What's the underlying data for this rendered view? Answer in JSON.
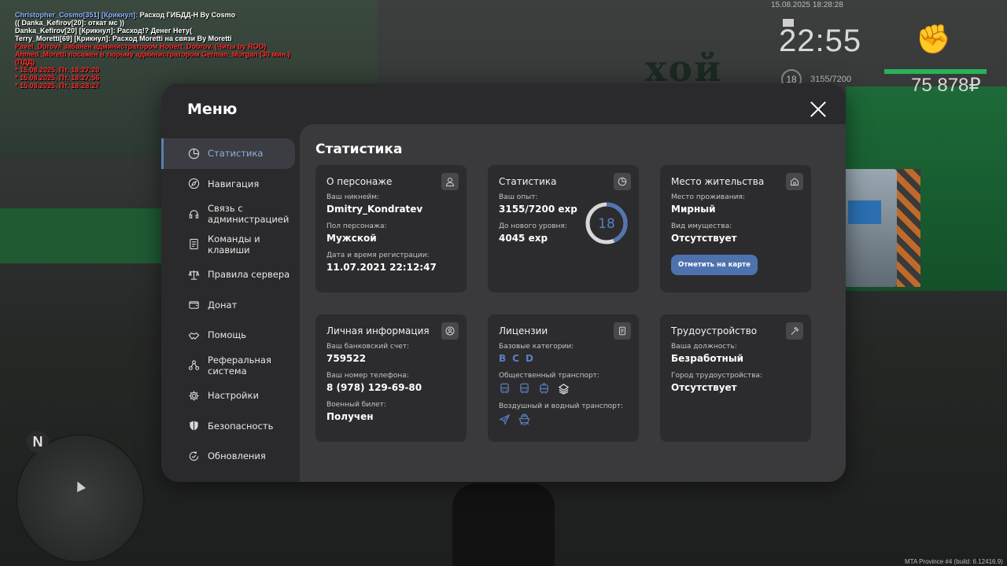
{
  "chat": [
    {
      "color": "blue",
      "prefix": "Christopher_Cosmo[351] [Крикнул]:",
      "text": " Расход ГИБДД-Н By Cosmo"
    },
    {
      "color": "white",
      "prefix": "",
      "text": "(( Danka_Kefirov[20]: откат мс ))"
    },
    {
      "color": "white",
      "prefix": "",
      "text": "Danka_Kefirov[20] [Крикнул]: Расход!? Денег Нету("
    },
    {
      "color": "white",
      "prefix": "",
      "text": "Terry_Moretti[69] [Крикнул]: Расход Moretti на связи By Moretti"
    },
    {
      "color": "red",
      "prefix": "",
      "text": "Pavel_Durov# забанен администратором Hobert_Dobrov. (Читы by ROD)"
    },
    {
      "color": "red",
      "prefix": "",
      "text": "Ahmed_Moretti посажен в тюрьму администратором German_Morgan (30 мин.)"
    },
    {
      "color": "red",
      "prefix": "",
      "text": "(ПДД)"
    },
    {
      "color": "red",
      "prefix": "",
      "text": "* 15.08.2025, Пт, 18:27:20"
    },
    {
      "color": "red",
      "prefix": "",
      "text": "* 15.08.2025, Пт, 18:27:56"
    },
    {
      "color": "red",
      "prefix": "",
      "text": "* 15.08.2025, Пт, 18:28:27"
    }
  ],
  "hud": {
    "date": "15.08.2025 18:28:28",
    "time": "22:55",
    "level": "18",
    "exp": "3155/7200",
    "health_fraction": 1.0,
    "money": "75 878₽"
  },
  "background": {
    "store_sign": "хой"
  },
  "minimap": {
    "north": "N"
  },
  "build": "MTA Province #4 (build: 6.12416.9)",
  "menu": {
    "title": "Меню",
    "sidebar": [
      {
        "label": "Статистика",
        "icon": "pie-chart-icon",
        "active": true
      },
      {
        "label": "Навигация",
        "icon": "compass-icon",
        "active": false
      },
      {
        "label": "Связь с администрацией",
        "icon": "headset-icon",
        "active": false
      },
      {
        "label": "Команды и клавиши",
        "icon": "document-icon",
        "active": false
      },
      {
        "label": "Правила сервера",
        "icon": "scales-icon",
        "active": false
      },
      {
        "label": "Донат",
        "icon": "wallet-icon",
        "active": false
      },
      {
        "label": "Помощь",
        "icon": "handshake-icon",
        "active": false
      },
      {
        "label": "Реферальная система",
        "icon": "network-icon",
        "active": false
      },
      {
        "label": "Настройки",
        "icon": "gear-icon",
        "active": false
      },
      {
        "label": "Безопасность",
        "icon": "shield-icon",
        "active": false
      },
      {
        "label": "Обновления",
        "icon": "refresh-check-icon",
        "active": false
      }
    ],
    "content_title": "Статистика",
    "cards": {
      "character": {
        "title": "О персонаже",
        "nick_label": "Ваш никнейм:",
        "nick": "Dmitry_Kondratev",
        "gender_label": "Пол персонажа:",
        "gender": "Мужской",
        "reg_label": "Дата и время регистрации:",
        "reg": "11.07.2021 22:12:47"
      },
      "stats": {
        "title": "Статистика",
        "exp_label": "Ваш опыт:",
        "exp": "3155/7200 exp",
        "next_label": "До нового уровня:",
        "next": "4045 exp",
        "level": "18",
        "progress": 0.438
      },
      "residence": {
        "title": "Место жительства",
        "place_label": "Место проживания:",
        "place": "Мирный",
        "property_label": "Вид имущества:",
        "property": "Отсутствует",
        "button": "Отметить на карте"
      },
      "personal": {
        "title": "Личная информация",
        "bank_label": "Ваш банковский счет:",
        "bank": "759522",
        "phone_label": "Ваш номер телефона:",
        "phone": "8 (978) 129-69-80",
        "military_label": "Военный билет:",
        "military": "Получен"
      },
      "licenses": {
        "title": "Лицензии",
        "base_label": "Базовые категории:",
        "base": [
          "B",
          "C",
          "D"
        ],
        "public_label": "Общественный транспорт:",
        "public_icons": [
          "bus-icon",
          "bus-icon",
          "tram-icon",
          "taxi-icon"
        ],
        "air_label": "Воздушный и водный транспорт:",
        "air_icons": [
          "plane-icon",
          "boat-icon"
        ]
      },
      "job": {
        "title": "Трудоустройство",
        "position_label": "Ваша должность:",
        "position": "Безработный",
        "city_label": "Город трудоустройства:",
        "city": "Отсутствует"
      }
    }
  }
}
